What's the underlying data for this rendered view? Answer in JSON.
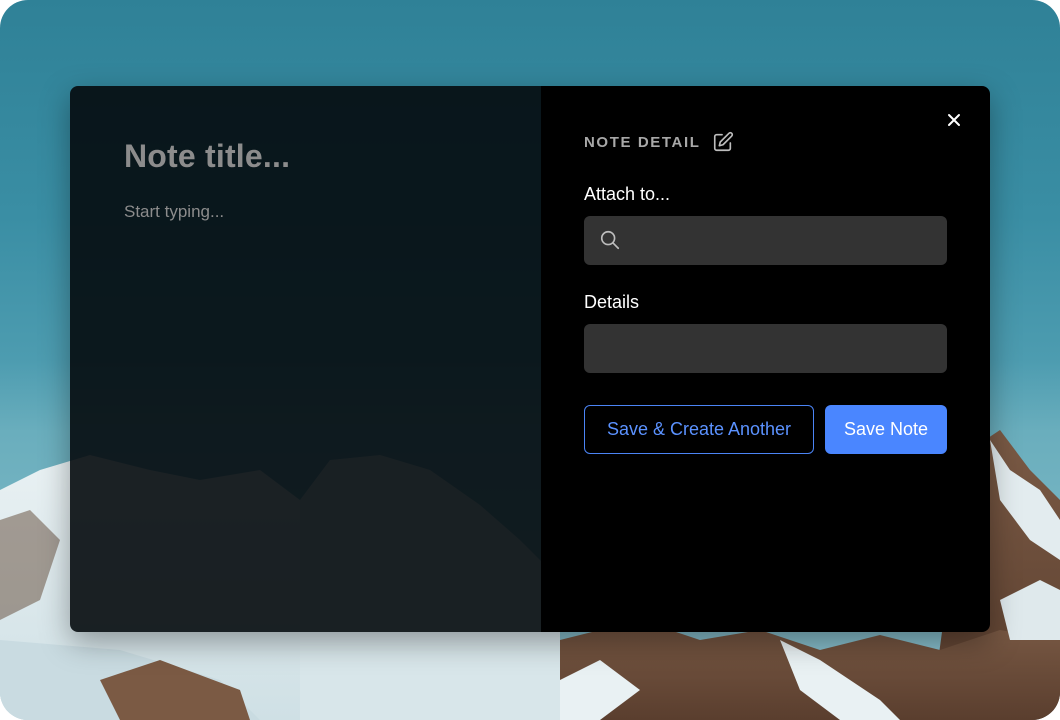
{
  "note": {
    "title_placeholder": "Note title...",
    "body_placeholder": "Start typing..."
  },
  "detail": {
    "heading": "NOTE DETAIL",
    "attach_label": "Attach to...",
    "attach_value": "",
    "details_label": "Details",
    "details_value": ""
  },
  "actions": {
    "save_create_another": "Save & Create Another",
    "save_note": "Save Note"
  },
  "colors": {
    "accent": "#4a86ff",
    "panel": "#000000",
    "field": "#333333"
  },
  "icons": [
    "close-icon",
    "edit-icon",
    "search-icon"
  ]
}
